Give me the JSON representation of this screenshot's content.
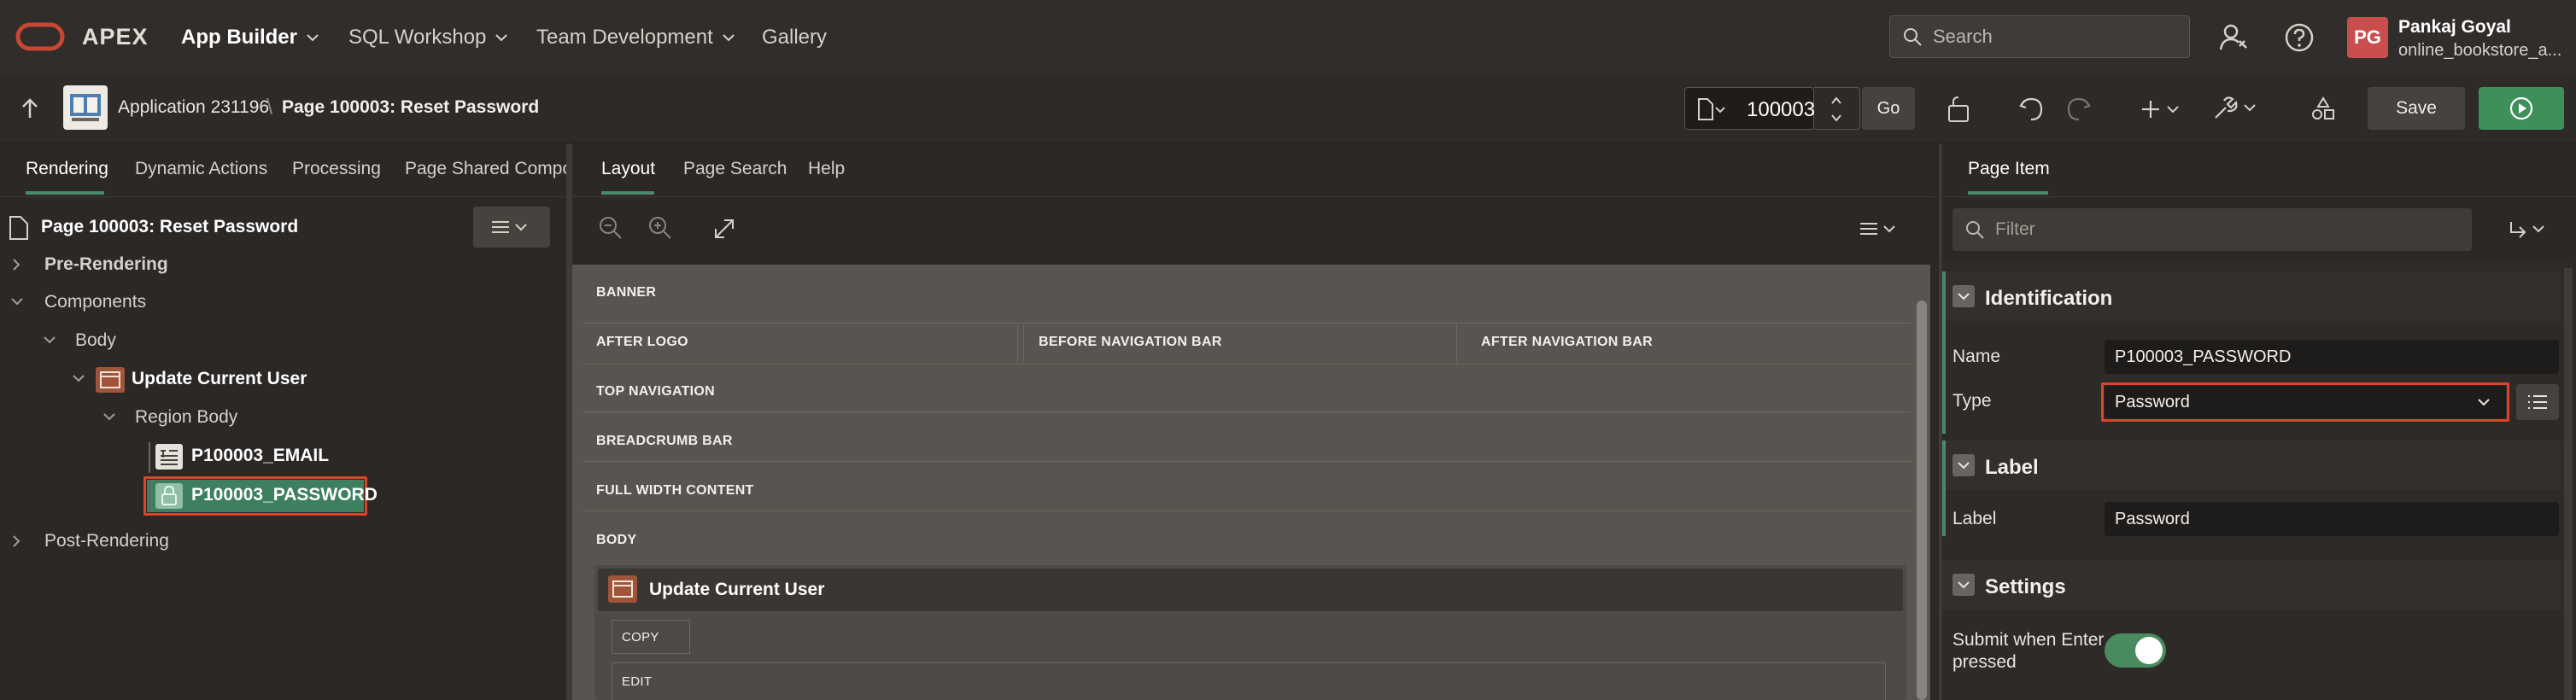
{
  "topnav": {
    "brand": "APEX",
    "menus": [
      {
        "label": "App Builder",
        "has_dropdown": true
      },
      {
        "label": "SQL Workshop",
        "has_dropdown": true
      },
      {
        "label": "Team Development",
        "has_dropdown": true
      },
      {
        "label": "Gallery",
        "has_dropdown": false
      }
    ],
    "search_placeholder": "Search",
    "user": {
      "initials": "PG",
      "name": "Pankaj Goyal",
      "workspace": "online_bookstore_a..."
    }
  },
  "toolbar": {
    "application": "Application 231196",
    "page_title": "Page 100003: Reset Password",
    "page_number": "100003",
    "go_label": "Go",
    "save_label": "Save"
  },
  "left": {
    "tabs": [
      "Rendering",
      "Dynamic Actions",
      "Processing",
      "Page Shared Compor"
    ],
    "tree": {
      "root": "Page 100003: Reset Password",
      "pre_rendering": "Pre-Rendering",
      "components": "Components",
      "body": "Body",
      "region": "Update Current User",
      "region_body": "Region Body",
      "item_email": "P100003_EMAIL",
      "item_password": "P100003_PASSWORD",
      "post_rendering": "Post-Rendering"
    }
  },
  "center": {
    "tabs": [
      "Layout",
      "Page Search",
      "Help"
    ],
    "regions": {
      "banner": "BANNER",
      "after_logo": "AFTER LOGO",
      "before_nav": "BEFORE NAVIGATION BAR",
      "after_nav": "AFTER NAVIGATION BAR",
      "top_nav": "TOP NAVIGATION",
      "breadcrumb": "BREADCRUMB BAR",
      "full_width": "FULL WIDTH CONTENT",
      "body": "BODY",
      "region_title": "Update Current User",
      "copy": "COPY",
      "edit": "EDIT"
    }
  },
  "right": {
    "tab": "Page Item",
    "filter_placeholder": "Filter",
    "identification": {
      "title": "Identification",
      "name_label": "Name",
      "name_value": "P100003_PASSWORD",
      "type_label": "Type",
      "type_value": "Password"
    },
    "label_section": {
      "title": "Label",
      "label_label": "Label",
      "label_value": "Password"
    },
    "settings": {
      "title": "Settings",
      "submit_label_1": "Submit when Enter",
      "submit_label_2": "pressed",
      "submit_enabled": true
    }
  },
  "colors": {
    "accent_green": "#4a8a6b",
    "highlight_red": "#d9442a",
    "run_green": "#3f8f5a",
    "avatar_red": "#c94f4f"
  }
}
